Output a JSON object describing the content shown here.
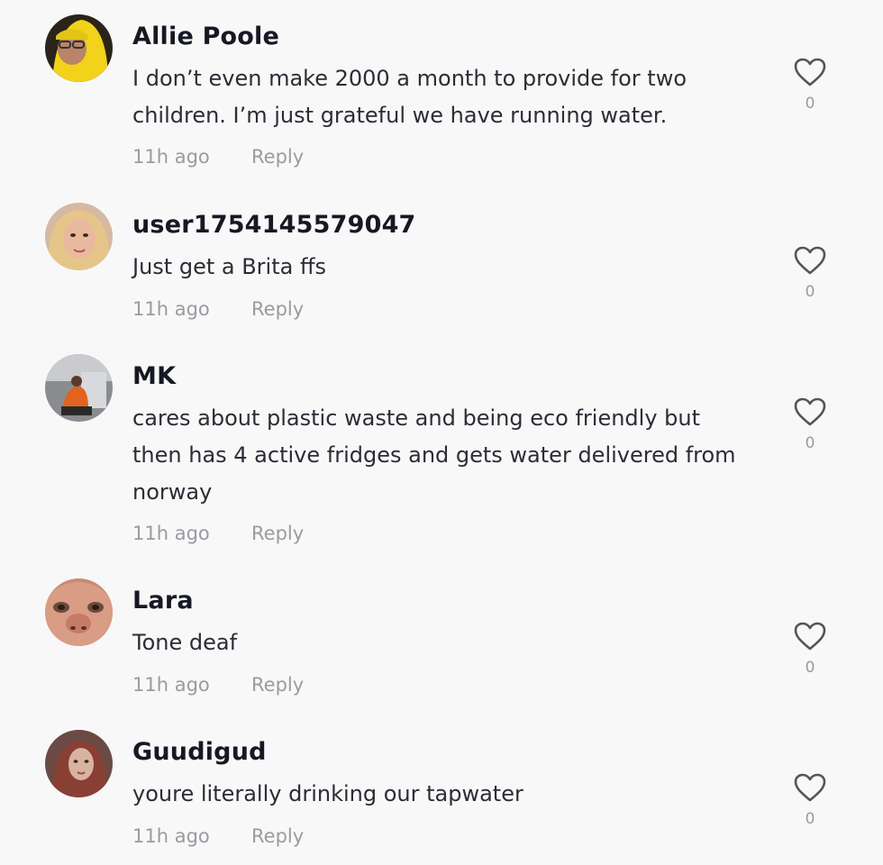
{
  "comments": [
    {
      "username": "Allie Poole",
      "text": "I don’t even make 2000 a month to provide for two children. I’m just grateful we have running water.",
      "time": "11h ago",
      "reply": "Reply",
      "likes": "0"
    },
    {
      "username": "user1754145579047",
      "text": "Just get a Brita ffs",
      "time": "11h ago",
      "reply": "Reply",
      "likes": "0"
    },
    {
      "username": "MK",
      "text": "cares about plastic waste and being eco friendly but then has 4 active fridges and gets water delivered from norway",
      "time": "11h ago",
      "reply": "Reply",
      "likes": "0"
    },
    {
      "username": "Lara",
      "text": "Tone deaf",
      "time": "11h ago",
      "reply": "Reply",
      "likes": "0"
    },
    {
      "username": "Guudigud",
      "text": "youre literally drinking our tapwater",
      "time": "11h ago",
      "reply": "Reply",
      "likes": "0"
    }
  ],
  "icons": {
    "like": "heart-outline-icon"
  },
  "colors": {
    "background": "#f8f8f8",
    "username": "#161823",
    "text": "#2b2d36",
    "muted": "#9a9ba1"
  }
}
